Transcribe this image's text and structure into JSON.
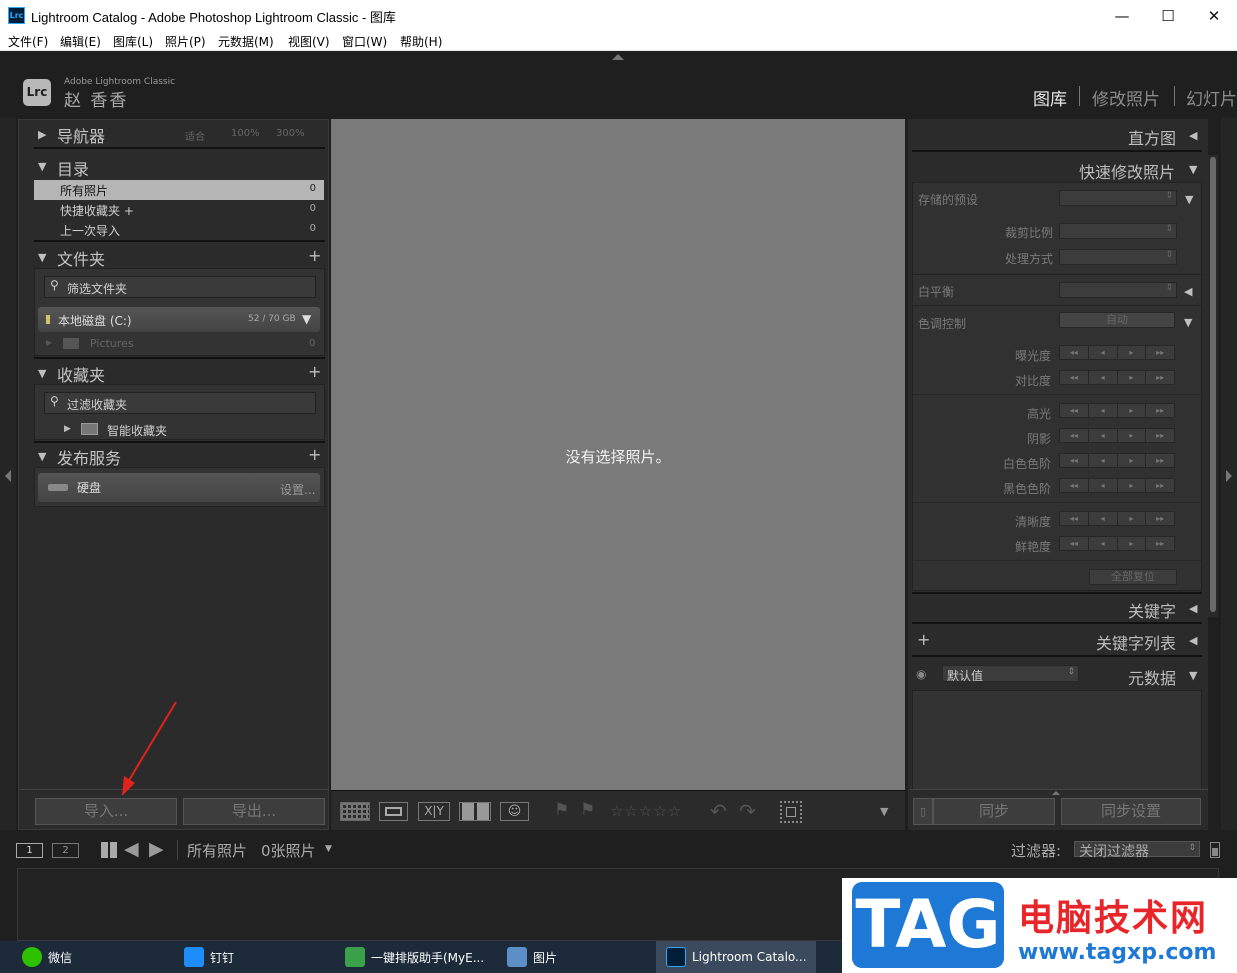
{
  "window": {
    "title": "Lightroom Catalog - Adobe Photoshop Lightroom Classic - 图库",
    "app_icon_text": "Lrc",
    "minimize": "—",
    "maximize": "☐",
    "close": "✕"
  },
  "menu": [
    "文件(F)",
    "编辑(E)",
    "图库(L)",
    "照片(P)",
    "元数据(M)",
    "视图(V)",
    "窗口(W)",
    "帮助(H)"
  ],
  "identity": {
    "logo": "Lrc",
    "small": "Adobe Lightroom Classic",
    "name": "赵 香香"
  },
  "modules": [
    "图库",
    "修改照片",
    "幻灯片"
  ],
  "left": {
    "navigator": {
      "title": "导航器",
      "zoom": [
        "适合",
        "100%",
        "300%"
      ]
    },
    "catalog": {
      "title": "目录",
      "rows": [
        {
          "label": "所有照片",
          "count": "0"
        },
        {
          "label": "快捷收藏夹 +",
          "count": "0"
        },
        {
          "label": "上一次导入",
          "count": "0"
        }
      ]
    },
    "folders": {
      "title": "文件夹",
      "filter": "筛选文件夹",
      "drive": "本地磁盘 (C:)",
      "drive_size": "52 / 70 GB",
      "subfolder": "Pictures",
      "subfolder_count": "0"
    },
    "collections": {
      "title": "收藏夹",
      "filter": "过滤收藏夹",
      "smart": "智能收藏夹"
    },
    "publish": {
      "title": "发布服务",
      "service": "硬盘",
      "settings": "设置..."
    },
    "import_button": "导入...",
    "export_button": "导出..."
  },
  "center": {
    "message": "没有选择照片。"
  },
  "right": {
    "histogram": "直方图",
    "quick_develop": "快速修改照片",
    "saved_preset": "存储的预设",
    "crop_ratio": "裁剪比例",
    "treatment": "处理方式",
    "white_balance": "白平衡",
    "tone_control": "色调控制",
    "auto": "自动",
    "sliders_a": [
      "曝光度",
      "对比度"
    ],
    "sliders_b": [
      "高光",
      "阴影",
      "白色色阶",
      "黑色色阶"
    ],
    "sliders_c": [
      "清晰度",
      "鲜艳度"
    ],
    "reset_all": "全部复位",
    "keywording": "关键字",
    "keyword_list": "关键字列表",
    "metadata": "元数据",
    "metadata_preset": "默认值",
    "sync": "同步",
    "sync_settings": "同步设置"
  },
  "filmbar": {
    "screen1": "1",
    "screen2": "2",
    "source": "所有照片",
    "count": "0张照片",
    "filter_label": "过滤器:",
    "filter_value": "关闭过滤器"
  },
  "taskbar": [
    {
      "label": "微信",
      "color": "#2dc100"
    },
    {
      "label": "钉钉",
      "color": "#1e8cfa"
    },
    {
      "label": "一键排版助手(MyE...",
      "color": "#3aa04a"
    },
    {
      "label": "图片",
      "color": "#5b8fc7"
    },
    {
      "label": "Lightroom Catalo...",
      "color": "#001e36"
    }
  ],
  "watermark": {
    "tag": "TAG",
    "site_cn": "电脑技术网",
    "url": "www.tagxp.com"
  }
}
